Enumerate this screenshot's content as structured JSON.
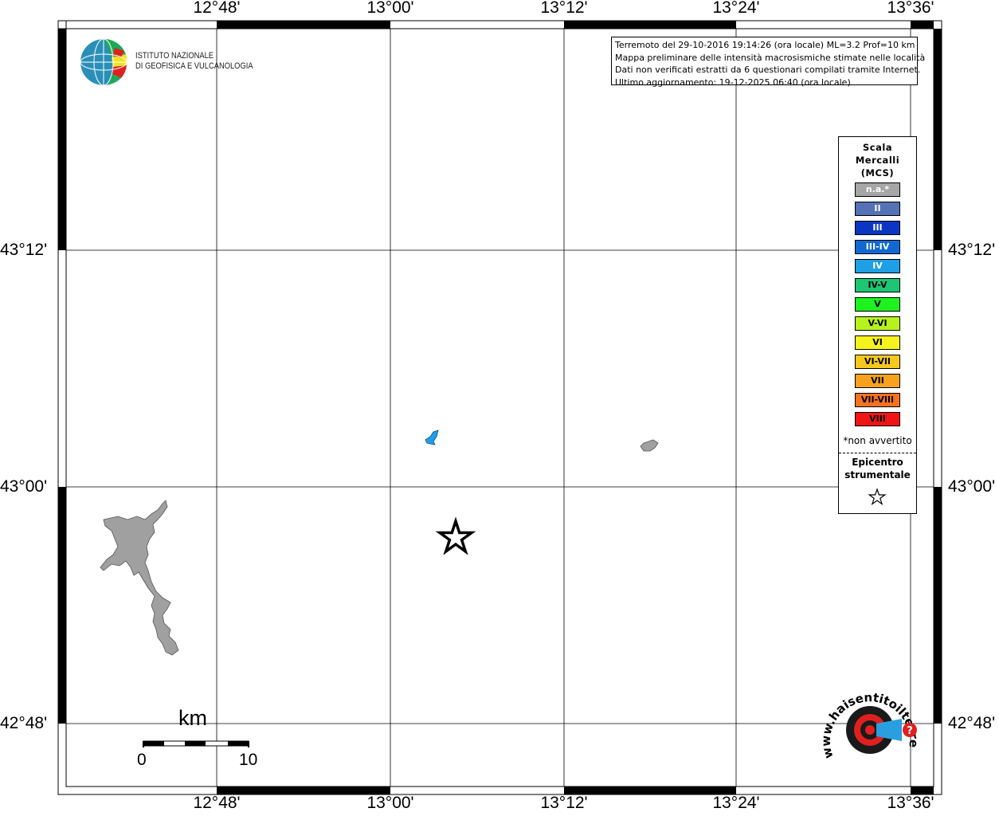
{
  "map": {
    "top_longitude_labels": [
      "12°48'",
      "13°00'",
      "13°12'",
      "13°24'",
      "13°36'"
    ],
    "bottom_longitude_labels": [
      "12°48'",
      "13°00'",
      "13°12'",
      "13°24'",
      "13°36'"
    ],
    "left_latitude_labels": [
      "43°12'",
      "43°00'",
      "42°48'"
    ],
    "right_latitude_labels": [
      "43°12'",
      "43°00'",
      "42°48'"
    ],
    "epicenter_icon": "star-icon"
  },
  "logo": {
    "line1": "ISTITUTO NAZIONALE",
    "line2": "DI GEOFISICA E VULCANOLOGIA"
  },
  "info_box": {
    "line1": "Terremoto del 29-10-2016 19:14:26 (ora locale) ML=3.2 Prof=10 km",
    "line2": "Mappa preliminare delle intensità macrosismiche stimate nelle località",
    "line3": "Dati non verificati estratti da 6 questionari compilati tramite Internet.",
    "line4": "Ultimo aggiornamento: 19-12-2025 06:40 (ora locale)"
  },
  "legend": {
    "title_line1": "Scala",
    "title_line2": "Mercalli",
    "title_line3": "(MCS)",
    "items": [
      {
        "label": "n.a.*",
        "color": "#a6a6a6",
        "text_color": "#ffffff"
      },
      {
        "label": "II",
        "color": "#5472b5",
        "text_color": "#ffffff"
      },
      {
        "label": "III",
        "color": "#0a37c2",
        "text_color": "#ffffff"
      },
      {
        "label": "III-IV",
        "color": "#1069d3",
        "text_color": "#ffffff"
      },
      {
        "label": "IV",
        "color": "#1e9fe6",
        "text_color": "#ffffff"
      },
      {
        "label": "IV-V",
        "color": "#1ec673",
        "text_color": "#000000"
      },
      {
        "label": "V",
        "color": "#1ef21e",
        "text_color": "#000000"
      },
      {
        "label": "V-VI",
        "color": "#b6f21e",
        "text_color": "#000000"
      },
      {
        "label": "VI",
        "color": "#f6f21e",
        "text_color": "#000000"
      },
      {
        "label": "VI-VII",
        "color": "#f6c81e",
        "text_color": "#000000"
      },
      {
        "label": "VII",
        "color": "#f6a21e",
        "text_color": "#000000"
      },
      {
        "label": "VII-VIII",
        "color": "#f6721e",
        "text_color": "#000000"
      },
      {
        "label": "VIII",
        "color": "#f01414",
        "text_color": "#000000"
      }
    ],
    "note": "*non avvertito",
    "epicenter_line1": "Epicentro",
    "epicenter_line2": "strumentale"
  },
  "scale_bar": {
    "unit": "km",
    "start": "0",
    "end": "10"
  },
  "watermark": {
    "text": "www.haisentitoilterremoto.it"
  }
}
